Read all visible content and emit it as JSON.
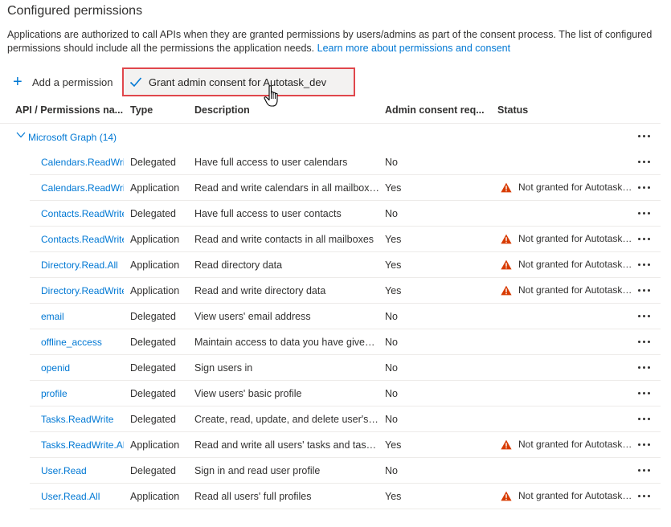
{
  "page": {
    "title": "Configured permissions",
    "description": "Applications are authorized to call APIs when they are granted permissions by users/admins as part of the consent process. The list of configured permissions should include all the permissions the application needs.",
    "learn_more_link": "Learn more about permissions and consent"
  },
  "toolbar": {
    "add_permission_label": "Add a permission",
    "grant_consent_label": "Grant admin consent for Autotask_dev"
  },
  "table": {
    "headers": {
      "name": "API / Permissions na...",
      "type": "Type",
      "description": "Description",
      "admin_consent": "Admin consent req...",
      "status": "Status"
    },
    "group_label": "Microsoft Graph (14)",
    "rows": [
      {
        "name": "Calendars.ReadWrite",
        "type": "Delegated",
        "description": "Have full access to user calendars",
        "admin_consent": "No",
        "status": ""
      },
      {
        "name": "Calendars.ReadWrite",
        "type": "Application",
        "description": "Read and write calendars in all mailboxes",
        "admin_consent": "Yes",
        "status": "Not granted for Autotask_dev"
      },
      {
        "name": "Contacts.ReadWrite",
        "type": "Delegated",
        "description": "Have full access to user contacts",
        "admin_consent": "No",
        "status": ""
      },
      {
        "name": "Contacts.ReadWrite",
        "type": "Application",
        "description": "Read and write contacts in all mailboxes",
        "admin_consent": "Yes",
        "status": "Not granted for Autotask_dev"
      },
      {
        "name": "Directory.Read.All",
        "type": "Application",
        "description": "Read directory data",
        "admin_consent": "Yes",
        "status": "Not granted for Autotask_dev"
      },
      {
        "name": "Directory.ReadWrite.All",
        "type": "Application",
        "description": "Read and write directory data",
        "admin_consent": "Yes",
        "status": "Not granted for Autotask_dev"
      },
      {
        "name": "email",
        "type": "Delegated",
        "description": "View users' email address",
        "admin_consent": "No",
        "status": ""
      },
      {
        "name": "offline_access",
        "type": "Delegated",
        "description": "Maintain access to data you have given it access to",
        "admin_consent": "No",
        "status": ""
      },
      {
        "name": "openid",
        "type": "Delegated",
        "description": "Sign users in",
        "admin_consent": "No",
        "status": ""
      },
      {
        "name": "profile",
        "type": "Delegated",
        "description": "View users' basic profile",
        "admin_consent": "No",
        "status": ""
      },
      {
        "name": "Tasks.ReadWrite",
        "type": "Delegated",
        "description": "Create, read, update, and delete user's tasks",
        "admin_consent": "No",
        "status": ""
      },
      {
        "name": "Tasks.ReadWrite.All",
        "type": "Application",
        "description": "Read and write all users' tasks and tasklists",
        "admin_consent": "Yes",
        "status": "Not granted for Autotask_dev"
      },
      {
        "name": "User.Read",
        "type": "Delegated",
        "description": "Sign in and read user profile",
        "admin_consent": "No",
        "status": ""
      },
      {
        "name": "User.Read.All",
        "type": "Application",
        "description": "Read all users' full profiles",
        "admin_consent": "Yes",
        "status": "Not granted for Autotask_dev"
      }
    ]
  },
  "colors": {
    "link": "#0078d4",
    "warning": "#d83b01",
    "highlight_border": "#e0474c"
  }
}
